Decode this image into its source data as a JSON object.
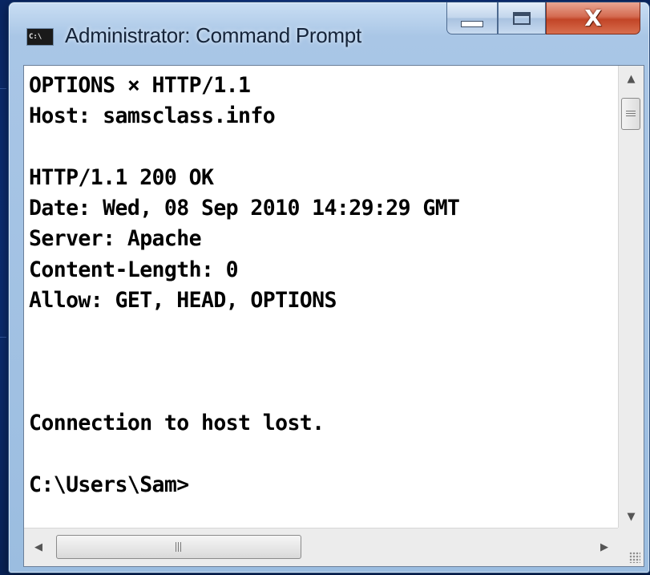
{
  "window": {
    "title": "Administrator: Command Prompt",
    "icon_text": "C:\\",
    "buttons": {
      "minimize": "minimize-icon",
      "maximize": "maximize-icon",
      "close": "close-icon",
      "close_glyph": "X"
    }
  },
  "console": {
    "lines": [
      "OPTIONS × HTTP/1.1",
      "Host: samsclass.info",
      "",
      "HTTP/1.1 200 OK",
      "Date: Wed, 08 Sep 2010 14:29:29 GMT",
      "Server: Apache",
      "Content-Length: 0",
      "Allow: GET, HEAD, OPTIONS",
      "",
      "",
      "",
      "Connection to host lost.",
      "",
      "C:\\Users\\Sam>"
    ]
  },
  "scrollbars": {
    "vertical": {
      "up": "▲",
      "down": "▼"
    },
    "horizontal": {
      "left": "◀",
      "right": "▶"
    }
  },
  "colors": {
    "desktop": "#0d2f78",
    "console_background": "#ffffff",
    "console_text": "#000000",
    "close_button": "#c24527"
  }
}
